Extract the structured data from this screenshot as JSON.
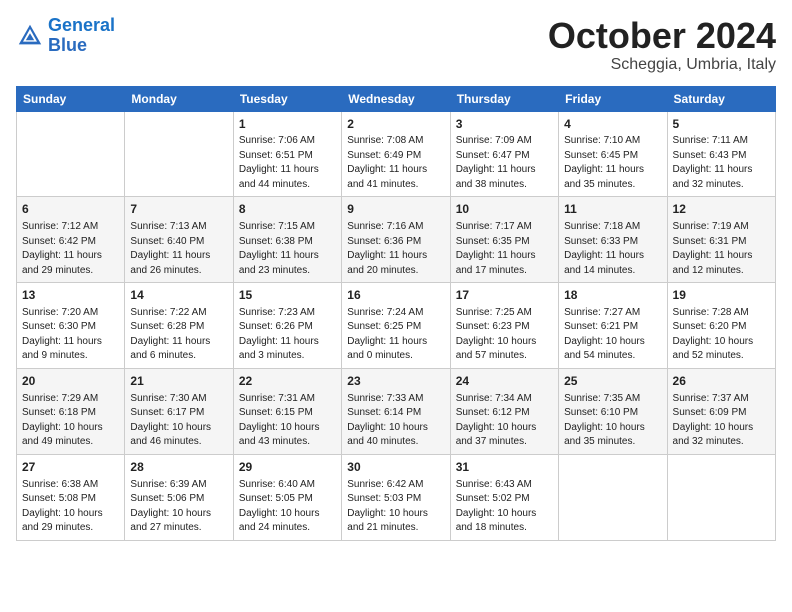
{
  "logo": {
    "line1": "General",
    "line2": "Blue"
  },
  "title": "October 2024",
  "location": "Scheggia, Umbria, Italy",
  "days_of_week": [
    "Sunday",
    "Monday",
    "Tuesday",
    "Wednesday",
    "Thursday",
    "Friday",
    "Saturday"
  ],
  "weeks": [
    [
      {
        "day": "",
        "sunrise": "",
        "sunset": "",
        "daylight": ""
      },
      {
        "day": "",
        "sunrise": "",
        "sunset": "",
        "daylight": ""
      },
      {
        "day": "1",
        "sunrise": "Sunrise: 7:06 AM",
        "sunset": "Sunset: 6:51 PM",
        "daylight": "Daylight: 11 hours and 44 minutes."
      },
      {
        "day": "2",
        "sunrise": "Sunrise: 7:08 AM",
        "sunset": "Sunset: 6:49 PM",
        "daylight": "Daylight: 11 hours and 41 minutes."
      },
      {
        "day": "3",
        "sunrise": "Sunrise: 7:09 AM",
        "sunset": "Sunset: 6:47 PM",
        "daylight": "Daylight: 11 hours and 38 minutes."
      },
      {
        "day": "4",
        "sunrise": "Sunrise: 7:10 AM",
        "sunset": "Sunset: 6:45 PM",
        "daylight": "Daylight: 11 hours and 35 minutes."
      },
      {
        "day": "5",
        "sunrise": "Sunrise: 7:11 AM",
        "sunset": "Sunset: 6:43 PM",
        "daylight": "Daylight: 11 hours and 32 minutes."
      }
    ],
    [
      {
        "day": "6",
        "sunrise": "Sunrise: 7:12 AM",
        "sunset": "Sunset: 6:42 PM",
        "daylight": "Daylight: 11 hours and 29 minutes."
      },
      {
        "day": "7",
        "sunrise": "Sunrise: 7:13 AM",
        "sunset": "Sunset: 6:40 PM",
        "daylight": "Daylight: 11 hours and 26 minutes."
      },
      {
        "day": "8",
        "sunrise": "Sunrise: 7:15 AM",
        "sunset": "Sunset: 6:38 PM",
        "daylight": "Daylight: 11 hours and 23 minutes."
      },
      {
        "day": "9",
        "sunrise": "Sunrise: 7:16 AM",
        "sunset": "Sunset: 6:36 PM",
        "daylight": "Daylight: 11 hours and 20 minutes."
      },
      {
        "day": "10",
        "sunrise": "Sunrise: 7:17 AM",
        "sunset": "Sunset: 6:35 PM",
        "daylight": "Daylight: 11 hours and 17 minutes."
      },
      {
        "day": "11",
        "sunrise": "Sunrise: 7:18 AM",
        "sunset": "Sunset: 6:33 PM",
        "daylight": "Daylight: 11 hours and 14 minutes."
      },
      {
        "day": "12",
        "sunrise": "Sunrise: 7:19 AM",
        "sunset": "Sunset: 6:31 PM",
        "daylight": "Daylight: 11 hours and 12 minutes."
      }
    ],
    [
      {
        "day": "13",
        "sunrise": "Sunrise: 7:20 AM",
        "sunset": "Sunset: 6:30 PM",
        "daylight": "Daylight: 11 hours and 9 minutes."
      },
      {
        "day": "14",
        "sunrise": "Sunrise: 7:22 AM",
        "sunset": "Sunset: 6:28 PM",
        "daylight": "Daylight: 11 hours and 6 minutes."
      },
      {
        "day": "15",
        "sunrise": "Sunrise: 7:23 AM",
        "sunset": "Sunset: 6:26 PM",
        "daylight": "Daylight: 11 hours and 3 minutes."
      },
      {
        "day": "16",
        "sunrise": "Sunrise: 7:24 AM",
        "sunset": "Sunset: 6:25 PM",
        "daylight": "Daylight: 11 hours and 0 minutes."
      },
      {
        "day": "17",
        "sunrise": "Sunrise: 7:25 AM",
        "sunset": "Sunset: 6:23 PM",
        "daylight": "Daylight: 10 hours and 57 minutes."
      },
      {
        "day": "18",
        "sunrise": "Sunrise: 7:27 AM",
        "sunset": "Sunset: 6:21 PM",
        "daylight": "Daylight: 10 hours and 54 minutes."
      },
      {
        "day": "19",
        "sunrise": "Sunrise: 7:28 AM",
        "sunset": "Sunset: 6:20 PM",
        "daylight": "Daylight: 10 hours and 52 minutes."
      }
    ],
    [
      {
        "day": "20",
        "sunrise": "Sunrise: 7:29 AM",
        "sunset": "Sunset: 6:18 PM",
        "daylight": "Daylight: 10 hours and 49 minutes."
      },
      {
        "day": "21",
        "sunrise": "Sunrise: 7:30 AM",
        "sunset": "Sunset: 6:17 PM",
        "daylight": "Daylight: 10 hours and 46 minutes."
      },
      {
        "day": "22",
        "sunrise": "Sunrise: 7:31 AM",
        "sunset": "Sunset: 6:15 PM",
        "daylight": "Daylight: 10 hours and 43 minutes."
      },
      {
        "day": "23",
        "sunrise": "Sunrise: 7:33 AM",
        "sunset": "Sunset: 6:14 PM",
        "daylight": "Daylight: 10 hours and 40 minutes."
      },
      {
        "day": "24",
        "sunrise": "Sunrise: 7:34 AM",
        "sunset": "Sunset: 6:12 PM",
        "daylight": "Daylight: 10 hours and 37 minutes."
      },
      {
        "day": "25",
        "sunrise": "Sunrise: 7:35 AM",
        "sunset": "Sunset: 6:10 PM",
        "daylight": "Daylight: 10 hours and 35 minutes."
      },
      {
        "day": "26",
        "sunrise": "Sunrise: 7:37 AM",
        "sunset": "Sunset: 6:09 PM",
        "daylight": "Daylight: 10 hours and 32 minutes."
      }
    ],
    [
      {
        "day": "27",
        "sunrise": "Sunrise: 6:38 AM",
        "sunset": "Sunset: 5:08 PM",
        "daylight": "Daylight: 10 hours and 29 minutes."
      },
      {
        "day": "28",
        "sunrise": "Sunrise: 6:39 AM",
        "sunset": "Sunset: 5:06 PM",
        "daylight": "Daylight: 10 hours and 27 minutes."
      },
      {
        "day": "29",
        "sunrise": "Sunrise: 6:40 AM",
        "sunset": "Sunset: 5:05 PM",
        "daylight": "Daylight: 10 hours and 24 minutes."
      },
      {
        "day": "30",
        "sunrise": "Sunrise: 6:42 AM",
        "sunset": "Sunset: 5:03 PM",
        "daylight": "Daylight: 10 hours and 21 minutes."
      },
      {
        "day": "31",
        "sunrise": "Sunrise: 6:43 AM",
        "sunset": "Sunset: 5:02 PM",
        "daylight": "Daylight: 10 hours and 18 minutes."
      },
      {
        "day": "",
        "sunrise": "",
        "sunset": "",
        "daylight": ""
      },
      {
        "day": "",
        "sunrise": "",
        "sunset": "",
        "daylight": ""
      }
    ]
  ]
}
